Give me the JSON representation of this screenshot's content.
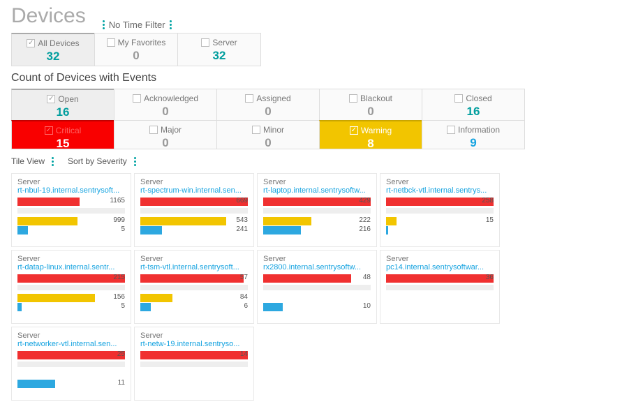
{
  "header": {
    "title": "Devices",
    "time_filter": "No Time Filter"
  },
  "device_filters": [
    {
      "id": "all",
      "label": "All Devices",
      "count": 32,
      "checked": true,
      "count_color": "teal"
    },
    {
      "id": "fav",
      "label": "My Favorites",
      "count": 0,
      "checked": false,
      "count_color": "grey"
    },
    {
      "id": "srv",
      "label": "Server",
      "count": 32,
      "checked": false,
      "count_color": "teal"
    }
  ],
  "section_title": "Count of Devices with Events",
  "status_filters": [
    {
      "id": "open",
      "label": "Open",
      "count": 16,
      "checked": true,
      "count_color": "teal"
    },
    {
      "id": "ack",
      "label": "Acknowledged",
      "count": 0,
      "checked": false,
      "count_color": "grey"
    },
    {
      "id": "assn",
      "label": "Assigned",
      "count": 0,
      "checked": false,
      "count_color": "grey"
    },
    {
      "id": "black",
      "label": "Blackout",
      "count": 0,
      "checked": false,
      "count_color": "grey"
    },
    {
      "id": "closed",
      "label": "Closed",
      "count": 16,
      "checked": false,
      "count_color": "teal"
    }
  ],
  "severity_filters": [
    {
      "id": "crit",
      "label": "Critical",
      "count": 15,
      "checked": true,
      "style": "critical"
    },
    {
      "id": "maj",
      "label": "Major",
      "count": 0,
      "checked": false,
      "style": "plain",
      "count_color": "grey"
    },
    {
      "id": "min",
      "label": "Minor",
      "count": 0,
      "checked": false,
      "style": "plain",
      "count_color": "grey"
    },
    {
      "id": "warn",
      "label": "Warning",
      "count": 8,
      "checked": true,
      "style": "warning"
    },
    {
      "id": "info",
      "label": "Information",
      "count": 9,
      "checked": false,
      "style": "plain",
      "count_color": "blue"
    }
  ],
  "view": {
    "mode": "Tile View",
    "sort": "Sort by Severity"
  },
  "tiles": [
    {
      "type": "Server",
      "name": "rt-nbul-19.internal.sentrysoft...",
      "bars": [
        {
          "color": "red",
          "pct": 58,
          "val": 1165
        },
        {
          "color": "gray"
        },
        {
          "color": "yellow",
          "pct": 56,
          "val": 999
        },
        {
          "color": "blue",
          "pct": 10,
          "val": 5
        }
      ]
    },
    {
      "type": "Server",
      "name": "rt-spectrum-win.internal.sen...",
      "bars": [
        {
          "color": "red",
          "pct": 100,
          "val": 669
        },
        {
          "color": "gray"
        },
        {
          "color": "yellow",
          "pct": 80,
          "val": 543
        },
        {
          "color": "blue",
          "pct": 20,
          "val": 241
        }
      ]
    },
    {
      "type": "Server",
      "name": "rt-laptop.internal.sentrysoftw...",
      "bars": [
        {
          "color": "red",
          "pct": 100,
          "val": 429
        },
        {
          "color": "gray"
        },
        {
          "color": "yellow",
          "pct": 45,
          "val": 222
        },
        {
          "color": "blue",
          "pct": 35,
          "val": 216
        }
      ]
    },
    {
      "type": "Server",
      "name": "rt-netbck-vtl.internal.sentrys...",
      "bars": [
        {
          "color": "red",
          "pct": 100,
          "val": 258
        },
        {
          "color": "gray"
        },
        {
          "color": "yellow",
          "pct": 10,
          "val": 15
        },
        {
          "color": "blue",
          "pct": 2,
          "val": ""
        }
      ]
    },
    {
      "type": "Server",
      "name": "rt-datap-linux.internal.sentr...",
      "bars": [
        {
          "color": "red",
          "pct": 100,
          "val": 215
        },
        {
          "color": "gray"
        },
        {
          "color": "yellow",
          "pct": 72,
          "val": 156
        },
        {
          "color": "blue",
          "pct": 4,
          "val": 5
        }
      ]
    },
    {
      "type": "Server",
      "name": "rt-tsm-vtl.internal.sentrysoft...",
      "bars": [
        {
          "color": "red",
          "pct": 96,
          "val": 57
        },
        {
          "color": "gray"
        },
        {
          "color": "yellow",
          "pct": 30,
          "val": 84
        },
        {
          "color": "blue",
          "pct": 10,
          "val": 6
        }
      ]
    },
    {
      "type": "Server",
      "name": "rx2800.internal.sentrysoftw...",
      "bars": [
        {
          "color": "red",
          "pct": 82,
          "val": 48
        },
        {
          "color": "gray"
        },
        {
          "color": "yellow",
          "pct": 0,
          "val": ""
        },
        {
          "color": "blue",
          "pct": 18,
          "val": 10
        }
      ]
    },
    {
      "type": "Server",
      "name": "pc14.internal.sentrysoftwar...",
      "bars": [
        {
          "color": "red",
          "pct": 100,
          "val": 36
        },
        {
          "color": "gray"
        },
        {
          "color": "yellow",
          "pct": 0,
          "val": ""
        },
        {
          "color": "blue",
          "pct": 0,
          "val": ""
        }
      ]
    },
    {
      "type": "Server",
      "name": "rt-networker-vtl.internal.sen...",
      "bars": [
        {
          "color": "red",
          "pct": 100,
          "val": 25
        },
        {
          "color": "gray"
        },
        {
          "color": "yellow",
          "pct": 0,
          "val": ""
        },
        {
          "color": "blue",
          "pct": 35,
          "val": 11
        }
      ]
    },
    {
      "type": "Server",
      "name": "rt-netw-19.internal.sentryso...",
      "bars": [
        {
          "color": "red",
          "pct": 100,
          "val": 14
        },
        {
          "color": "gray"
        },
        {
          "color": "yellow",
          "pct": 0,
          "val": ""
        },
        {
          "color": "blue",
          "pct": 0,
          "val": ""
        }
      ]
    }
  ]
}
